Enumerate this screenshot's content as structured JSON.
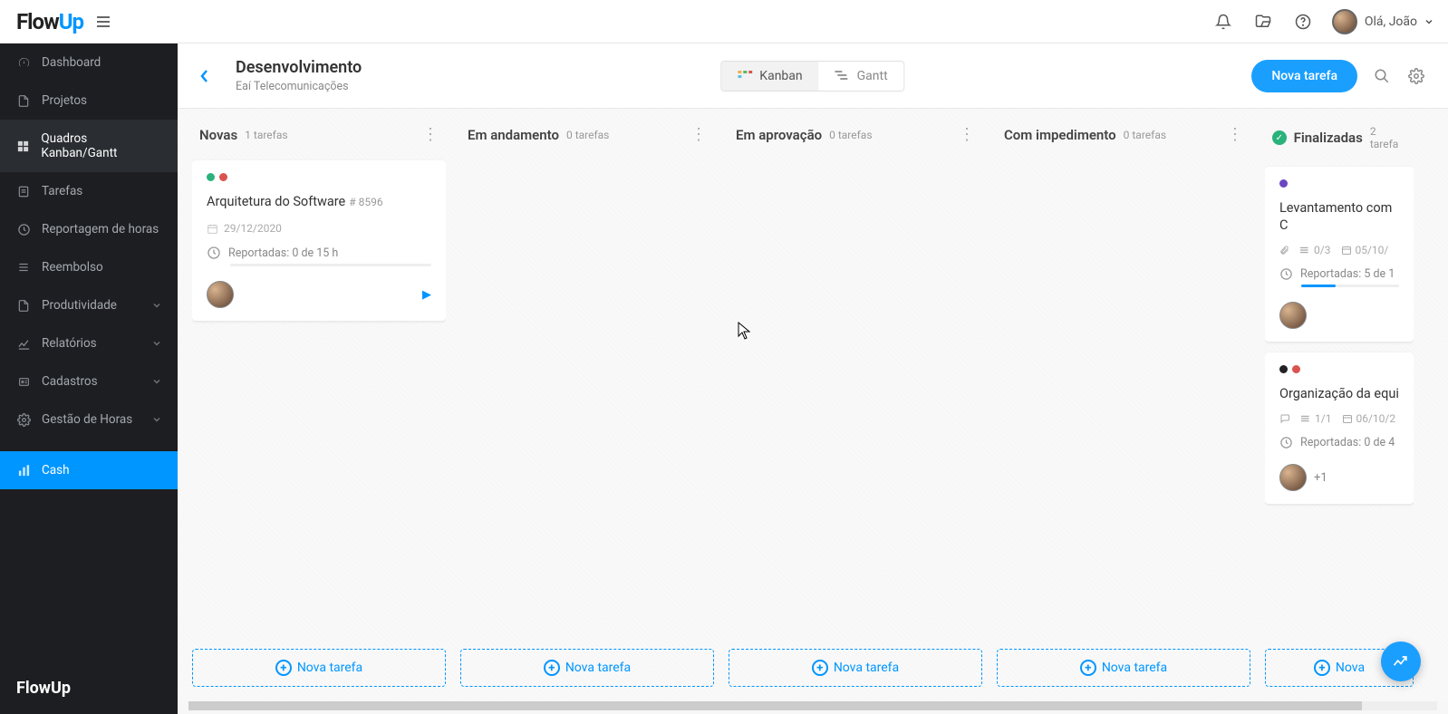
{
  "brand": {
    "part1": "Flow",
    "part2": "Up"
  },
  "greeting": "Olá, João",
  "sidebar": {
    "items": [
      {
        "label": "Dashboard",
        "icon": "gauge"
      },
      {
        "label": "Projetos",
        "icon": "doc"
      },
      {
        "label": "Quadros Kanban/Gantt",
        "icon": "board",
        "active": true
      },
      {
        "label": "Tarefas",
        "icon": "task"
      },
      {
        "label": "Reportagem de horas",
        "icon": "clock"
      },
      {
        "label": "Reembolso",
        "icon": "list"
      },
      {
        "label": "Produtividade",
        "icon": "doc",
        "expandable": true
      },
      {
        "label": "Relatórios",
        "icon": "chart",
        "expandable": true
      },
      {
        "label": "Cadastros",
        "icon": "card",
        "expandable": true
      },
      {
        "label": "Gestão de Horas",
        "icon": "gear",
        "expandable": true
      },
      {
        "label": "Cash",
        "icon": "bars",
        "highlighted": true
      }
    ]
  },
  "page": {
    "title": "Desenvolvimento",
    "subtitle": "Eaí Telecomunicações",
    "view_kanban": "Kanban",
    "view_gantt": "Gantt",
    "new_task": "Nova tarefa"
  },
  "columns": [
    {
      "title": "Novas",
      "count": "1 tarefas",
      "add_label": "Nova tarefa"
    },
    {
      "title": "Em andamento",
      "count": "0 tarefas",
      "add_label": "Nova tarefa"
    },
    {
      "title": "Em aprovação",
      "count": "0 tarefas",
      "add_label": "Nova tarefa"
    },
    {
      "title": "Com impedimento",
      "count": "0 tarefas",
      "add_label": "Nova tarefa"
    },
    {
      "title": "Finalizadas",
      "count": "2 tarefa",
      "add_label": "Nova",
      "done": true
    }
  ],
  "cards": {
    "card1": {
      "title": "Arquitetura do Software",
      "id": "# 8596",
      "date": "29/12/2020",
      "hours": "Reportadas: 0 de 15 h",
      "dots": [
        "#2ab27b",
        "#d9534f"
      ]
    },
    "card2": {
      "title": "Levantamento com C",
      "checklist": "0/3",
      "date": "05/10/",
      "hours": "Reportadas: 5 de 1",
      "dots": [
        "#6b46c1"
      ]
    },
    "card3": {
      "title": "Organização da equi",
      "checklist": "1/1",
      "date": "06/10/2",
      "hours": "Reportadas: 0 de 4",
      "extra": "+1",
      "dots": [
        "#222",
        "#d9534f"
      ]
    }
  }
}
